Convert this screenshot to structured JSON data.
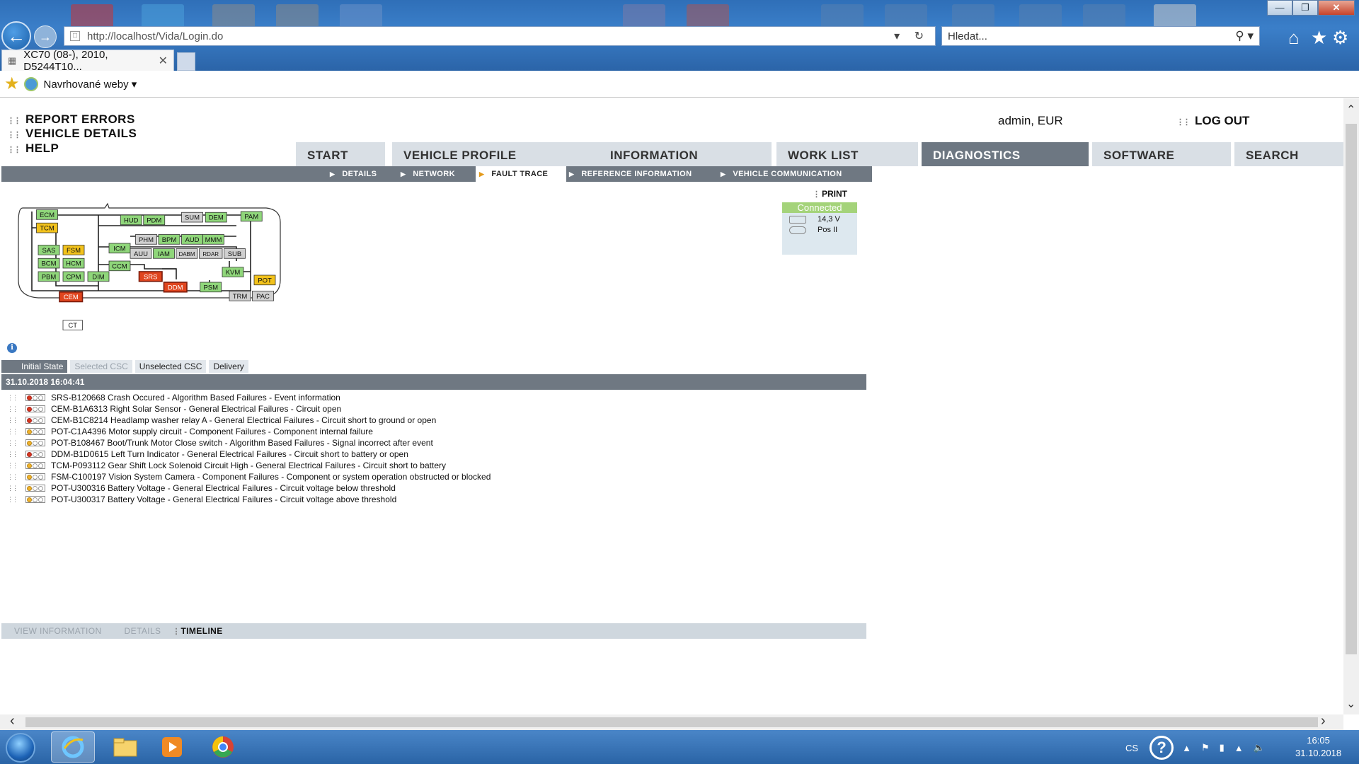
{
  "browser": {
    "url": "http://localhost/Vida/Login.do",
    "search_placeholder": "Hledat...",
    "tab_title": "XC70 (08-), 2010, D5244T10...",
    "favorites_label": "Navrhované weby"
  },
  "header": {
    "links": [
      "REPORT ERRORS",
      "VEHICLE DETAILS",
      "HELP"
    ],
    "user": "admin, EUR",
    "logout": "LOG OUT"
  },
  "main_tabs": [
    "START",
    "VEHICLE PROFILE",
    "INFORMATION",
    "WORK LIST",
    "DIAGNOSTICS",
    "SOFTWARE",
    "SEARCH"
  ],
  "active_main_tab": "DIAGNOSTICS",
  "sub_nav": [
    "DETAILS",
    "NETWORK",
    "FAULT TRACE",
    "REFERENCE INFORMATION",
    "VEHICLE COMMUNICATION"
  ],
  "active_sub_nav": "FAULT TRACE",
  "print_label": "PRINT",
  "connection": {
    "status": "Connected",
    "voltage": "14,3 V",
    "ignition": "Pos II"
  },
  "network": {
    "modules": [
      {
        "label": "ECM",
        "state": "ok"
      },
      {
        "label": "TCM",
        "state": "warn"
      },
      {
        "label": "HUD",
        "state": "ok"
      },
      {
        "label": "PDM",
        "state": "ok"
      },
      {
        "label": "SUM",
        "state": "none"
      },
      {
        "label": "DEM",
        "state": "ok"
      },
      {
        "label": "PAM",
        "state": "ok"
      },
      {
        "label": "SAS",
        "state": "ok"
      },
      {
        "label": "FSM",
        "state": "warn"
      },
      {
        "label": "BCM",
        "state": "ok"
      },
      {
        "label": "HCM",
        "state": "ok"
      },
      {
        "label": "PBM",
        "state": "ok"
      },
      {
        "label": "CPM",
        "state": "ok"
      },
      {
        "label": "DIM",
        "state": "ok"
      },
      {
        "label": "ICM",
        "state": "ok"
      },
      {
        "label": "PHM",
        "state": "none"
      },
      {
        "label": "BPM",
        "state": "ok"
      },
      {
        "label": "AUD",
        "state": "ok"
      },
      {
        "label": "MMM",
        "state": "ok"
      },
      {
        "label": "AUU",
        "state": "none"
      },
      {
        "label": "IAM",
        "state": "ok"
      },
      {
        "label": "DABM",
        "state": "none"
      },
      {
        "label": "RDAR",
        "state": "none"
      },
      {
        "label": "SUB",
        "state": "none"
      },
      {
        "label": "CCM",
        "state": "ok"
      },
      {
        "label": "SRS",
        "state": "fault"
      },
      {
        "label": "DDM",
        "state": "fault"
      },
      {
        "label": "KVM",
        "state": "ok"
      },
      {
        "label": "POT",
        "state": "warn"
      },
      {
        "label": "PSM",
        "state": "ok"
      },
      {
        "label": "TRM",
        "state": "none"
      },
      {
        "label": "PAC",
        "state": "none"
      },
      {
        "label": "CEM",
        "state": "fault"
      },
      {
        "label": "CT",
        "state": "plain"
      }
    ],
    "colors": {
      "ok": "#8fd67a",
      "warn": "#f2c21b",
      "fault": "#e0451e",
      "none": "#d0d0d0",
      "plain": "#ffffff"
    }
  },
  "state_tabs": [
    {
      "label": "Initial State",
      "state": "active"
    },
    {
      "label": "Selected CSC",
      "state": "disabled"
    },
    {
      "label": "Unselected CSC",
      "state": "normal"
    },
    {
      "label": "Delivery",
      "state": "normal"
    }
  ],
  "fault_list": {
    "timestamp": "31.10.2018 16:04:41",
    "rows": [
      {
        "lamp": "red",
        "text": "SRS-B120668 Crash Occured - Algorithm Based Failures - Event information"
      },
      {
        "lamp": "red",
        "text": "CEM-B1A6313 Right Solar Sensor - General Electrical Failures - Circuit open"
      },
      {
        "lamp": "red",
        "text": "CEM-B1C8214 Headlamp washer relay A - General Electrical Failures - Circuit short to ground or open"
      },
      {
        "lamp": "amber",
        "text": "POT-C1A4396 Motor supply circuit - Component Failures - Component internal failure"
      },
      {
        "lamp": "amber",
        "text": "POT-B108467 Boot/Trunk Motor Close switch - Algorithm Based Failures - Signal incorrect after event"
      },
      {
        "lamp": "red",
        "text": "DDM-B1D0615 Left Turn Indicator - General Electrical Failures - Circuit short to battery or open"
      },
      {
        "lamp": "amber",
        "text": "TCM-P093112 Gear Shift Lock Solenoid Circuit High - General Electrical Failures - Circuit short to battery"
      },
      {
        "lamp": "amber",
        "text": "FSM-C100197 Vision System Camera - Component Failures - Component or system operation obstructed or blocked"
      },
      {
        "lamp": "amber",
        "text": "POT-U300316 Battery Voltage - General Electrical Failures - Circuit voltage below threshold"
      },
      {
        "lamp": "amber",
        "text": "POT-U300317 Battery Voltage - General Electrical Failures - Circuit voltage above threshold"
      }
    ]
  },
  "bottom_nav": [
    {
      "label": "VIEW INFORMATION",
      "state": "disabled"
    },
    {
      "label": "DETAILS",
      "state": "disabled"
    },
    {
      "label": "TIMELINE",
      "state": "active"
    }
  ],
  "taskbar": {
    "lang": "CS",
    "time": "16:05",
    "date": "31.10.2018"
  }
}
